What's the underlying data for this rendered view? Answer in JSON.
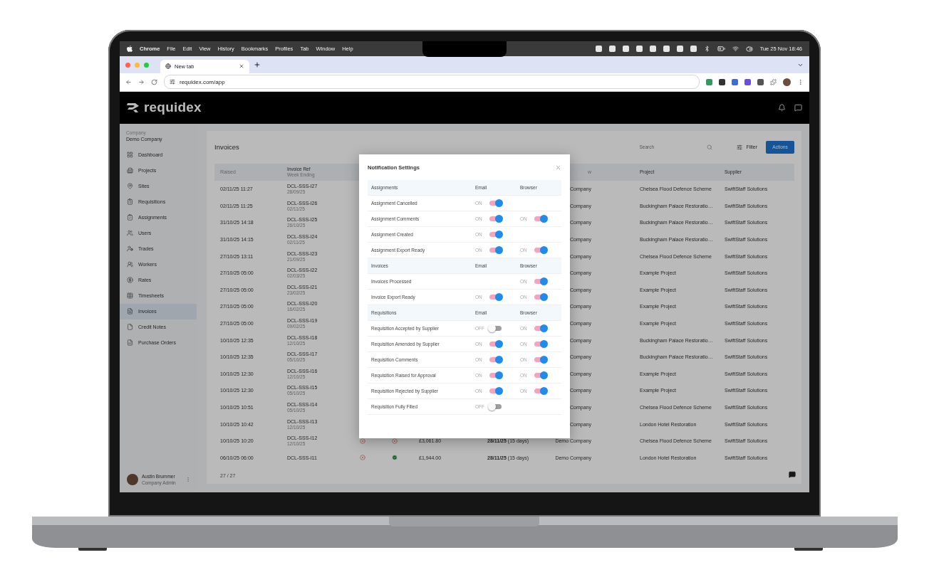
{
  "menubar": {
    "app": "Chrome",
    "menus": [
      "File",
      "Edit",
      "View",
      "History",
      "Bookmarks",
      "Profiles",
      "Tab",
      "Window",
      "Help"
    ],
    "clock": "Tue 25 Nov 18:46"
  },
  "browser": {
    "tab": {
      "title": "New tab",
      "selected": true
    },
    "url": "requidex.com/app"
  },
  "app": {
    "brand": "requidex",
    "sidebar": {
      "company_label": "Company",
      "company": "Demo Company",
      "items": [
        {
          "label": "Dashboard",
          "selected": false
        },
        {
          "label": "Projects",
          "selected": false
        },
        {
          "label": "Sites",
          "selected": false
        },
        {
          "label": "Requisitions",
          "selected": false
        },
        {
          "label": "Assignments",
          "selected": false
        },
        {
          "label": "Users",
          "selected": false
        },
        {
          "label": "Trades",
          "selected": false
        },
        {
          "label": "Workers",
          "selected": false
        },
        {
          "label": "Rates",
          "selected": false
        },
        {
          "label": "Timesheets",
          "selected": false
        },
        {
          "label": "Invoices",
          "selected": true
        },
        {
          "label": "Credit Notes",
          "selected": false
        },
        {
          "label": "Purchase Orders",
          "selected": false
        }
      ],
      "user": {
        "name": "Austin Brummer",
        "role": "Company Admin"
      }
    },
    "page": {
      "title": "Invoices",
      "search": {
        "placeholder": "Search"
      },
      "filter": "Filter",
      "actions": "Actions",
      "header": {
        "raised": "Raised",
        "ref": "Invoice Ref",
        "week_ending": "Week Ending",
        "client": "w",
        "project": "Project",
        "supplier": "Supplier"
      },
      "rows": [
        {
          "raised": "02/11/25 11:27",
          "ref": "DCL-SSS-I27",
          "week_ending": "28/09/25",
          "client": "Company",
          "project": "Chelsea Flood Defence Scheme",
          "supplier": "SwiftStaff Solutions"
        },
        {
          "raised": "02/11/25 11:25",
          "ref": "DCL-SSS-I26",
          "week_ending": "02/11/25",
          "client": "Company",
          "project": "Buckingham Palace Restoratio…",
          "supplier": "SwiftStaff Solutions"
        },
        {
          "raised": "31/10/25 14:18",
          "ref": "DCL-SSS-I25",
          "week_ending": "26/10/25",
          "client": "Company",
          "project": "Buckingham Palace Restoratio…",
          "supplier": "SwiftStaff Solutions"
        },
        {
          "raised": "31/10/25 14:15",
          "ref": "DCL-SSS-I24",
          "week_ending": "02/11/25",
          "client": "Company",
          "project": "Buckingham Palace Restoratio…",
          "supplier": "SwiftStaff Solutions"
        },
        {
          "raised": "27/10/25 13:11",
          "ref": "DCL-SSS-I23",
          "week_ending": "21/09/25",
          "client": "Company",
          "project": "Chelsea Flood Defence Scheme",
          "supplier": "SwiftStaff Solutions"
        },
        {
          "raised": "27/10/25 05:00",
          "ref": "DCL-SSS-I22",
          "week_ending": "02/03/25",
          "client": "Company",
          "project": "Example Project",
          "supplier": "SwiftStaff Solutions"
        },
        {
          "raised": "27/10/25 05:00",
          "ref": "DCL-SSS-I21",
          "week_ending": "23/02/25",
          "client": "Company",
          "project": "Example Project",
          "supplier": "SwiftStaff Solutions"
        },
        {
          "raised": "27/10/25 05:00",
          "ref": "DCL-SSS-I20",
          "week_ending": "16/02/25",
          "client": "Company",
          "project": "Example Project",
          "supplier": "SwiftStaff Solutions"
        },
        {
          "raised": "27/10/25 05:00",
          "ref": "DCL-SSS-I19",
          "week_ending": "09/02/25",
          "client": "Company",
          "project": "Example Project",
          "supplier": "SwiftStaff Solutions"
        },
        {
          "raised": "10/10/25 12:35",
          "ref": "DCL-SSS-I18",
          "week_ending": "12/10/25",
          "client": "Company",
          "project": "Buckingham Palace Restoratio…",
          "supplier": "SwiftStaff Solutions"
        },
        {
          "raised": "10/10/25 12:35",
          "ref": "DCL-SSS-I17",
          "week_ending": "05/10/25",
          "client": "Company",
          "project": "Buckingham Palace Restoratio…",
          "supplier": "SwiftStaff Solutions"
        },
        {
          "raised": "10/10/25 12:30",
          "ref": "DCL-SSS-I16",
          "week_ending": "12/10/25",
          "client": "Company",
          "project": "Example Project",
          "supplier": "SwiftStaff Solutions"
        },
        {
          "raised": "10/10/25 12:30",
          "ref": "DCL-SSS-I15",
          "week_ending": "05/10/25",
          "client": "Company",
          "project": "Example Project",
          "supplier": "SwiftStaff Solutions"
        },
        {
          "raised": "10/10/25 10:51",
          "ref": "DCL-SSS-I14",
          "week_ending": "05/10/25",
          "client": "Company",
          "project": "Chelsea Flood Defence Scheme",
          "supplier": "SwiftStaff Solutions"
        },
        {
          "raised": "10/10/25 10:42",
          "ref": "DCL-SSS-I13",
          "week_ending": "12/10/25",
          "client": "Company",
          "project": "London Hotel Restoration",
          "supplier": "SwiftStaff Solutions"
        },
        {
          "raised": "10/10/25 10:20",
          "ref": "DCL-SSS-I12",
          "week_ending": "12/10/25",
          "flags": [
            {
              "kind": "cross"
            },
            {
              "kind": "cross"
            }
          ],
          "amount": "£3,061.80",
          "due": "**28/11/25** (15 days)",
          "client": "Demo Company",
          "project": "Chelsea Flood Defence Scheme",
          "supplier": "SwiftStaff Solutions"
        },
        {
          "raised": "06/10/25 06:00",
          "ref": "DCL-SSS-I11",
          "flags": [
            {
              "kind": "cross"
            },
            {
              "kind": "check"
            }
          ],
          "amount": "£1,944.00",
          "due": "**28/11/25** (15 days)",
          "client": "Demo Company",
          "project": "London Hotel Restoration",
          "supplier": "SwiftStaff Solutions"
        }
      ],
      "count": "27 / 27"
    }
  },
  "modal": {
    "title": "Notification Settings",
    "sections": [
      {
        "title": "Assignments",
        "email": "Email",
        "browser": "Browser",
        "items": [
          {
            "label": "Assignment Cancelled",
            "email": {
              "text": "ON",
              "on": true
            }
          },
          {
            "label": "Assignment Comments",
            "email": {
              "text": "ON",
              "on": true
            },
            "browser": {
              "text": "ON",
              "on": true
            }
          },
          {
            "label": "Assignment Created",
            "email": {
              "text": "ON",
              "on": true
            }
          },
          {
            "label": "Assignment Export Ready",
            "email": {
              "text": "ON",
              "on": true
            },
            "browser": {
              "text": "ON",
              "on": true
            }
          }
        ]
      },
      {
        "title": "Invoices",
        "email": "Email",
        "browser": "Browser",
        "items": [
          {
            "label": "Invoices Processed",
            "browser": {
              "text": "ON",
              "on": true
            }
          },
          {
            "label": "Invoice Export Ready",
            "email": {
              "text": "ON",
              "on": true
            },
            "browser": {
              "text": "ON",
              "on": true
            }
          }
        ]
      },
      {
        "title": "Requisitions",
        "email": "Email",
        "browser": "Browser",
        "items": [
          {
            "label": "Requisition Accepted by Supplier",
            "email": {
              "text": "OFF",
              "on": false
            },
            "browser": {
              "text": "ON",
              "on": true
            }
          },
          {
            "label": "Requisition Amended by Supplier",
            "email": {
              "text": "ON",
              "on": true
            },
            "browser": {
              "text": "ON",
              "on": true
            }
          },
          {
            "label": "Requisition Comments",
            "email": {
              "text": "ON",
              "on": true
            },
            "browser": {
              "text": "ON",
              "on": true
            }
          },
          {
            "label": "Requisition Raised for Approval",
            "email": {
              "text": "ON",
              "on": true
            },
            "browser": {
              "text": "ON",
              "on": true
            }
          },
          {
            "label": "Requisition Rejected by Supplier",
            "email": {
              "text": "ON",
              "on": true
            },
            "browser": {
              "text": "ON",
              "on": true
            }
          },
          {
            "label": "Requisition Fully Filled",
            "email": {
              "text": "OFF",
              "on": false
            }
          }
        ]
      }
    ]
  }
}
